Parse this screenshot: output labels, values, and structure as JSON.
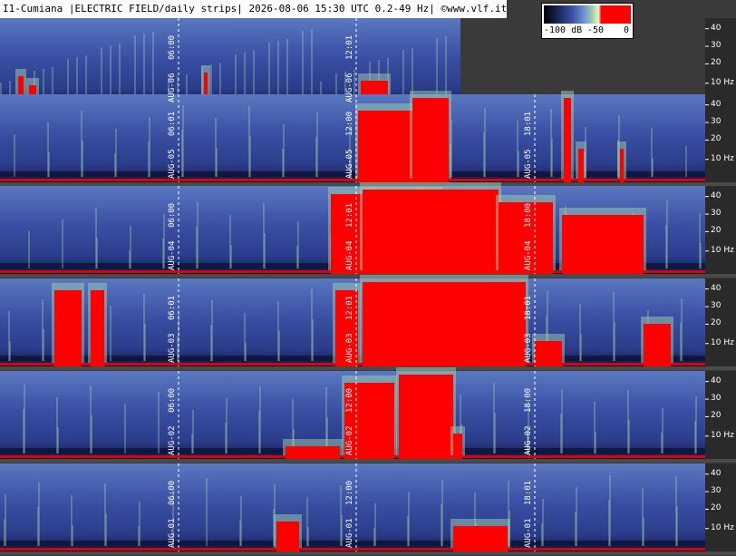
{
  "header": {
    "title": "I1-Cumiana |ELECTRIC FIELD/daily strips| 2026-08-06 15:30 UTC 0.2-49 Hz| ©www.vlf.it"
  },
  "scale": {
    "labels": [
      "-100 dB",
      "-50",
      "0"
    ],
    "colors": [
      "#000000",
      "#16204d",
      "#3a4fa3",
      "#6f8fd0",
      "#9fd0b0",
      "#f2f2c0",
      "#ff0000"
    ]
  },
  "frequency_labels": [
    "40",
    "30",
    "20",
    "10 Hz"
  ],
  "strips": [
    {
      "day": "AUG-06",
      "times": [
        "06:00",
        "12:01"
      ],
      "partial": true
    },
    {
      "day": "AUG-05",
      "times": [
        "06:01",
        "12:00",
        "18:01"
      ]
    },
    {
      "day": "AUG-04",
      "times": [
        "06:00",
        "12:01",
        "18:00"
      ]
    },
    {
      "day": "AUG-03",
      "times": [
        "06:01",
        "12:01",
        "18:01"
      ]
    },
    {
      "day": "AUG-02",
      "times": [
        "06:00",
        "12:00",
        "18:00"
      ]
    },
    {
      "day": "AUG-01",
      "times": [
        "06:00",
        "12:00",
        "18:01"
      ]
    }
  ],
  "colors": {
    "background": "#3a3a3a",
    "spectrogram_base": "#3a4fa3",
    "spectrogram_high": "#9fd0b0",
    "saturation": "#ff0000",
    "gap": "#4a4a4a"
  }
}
